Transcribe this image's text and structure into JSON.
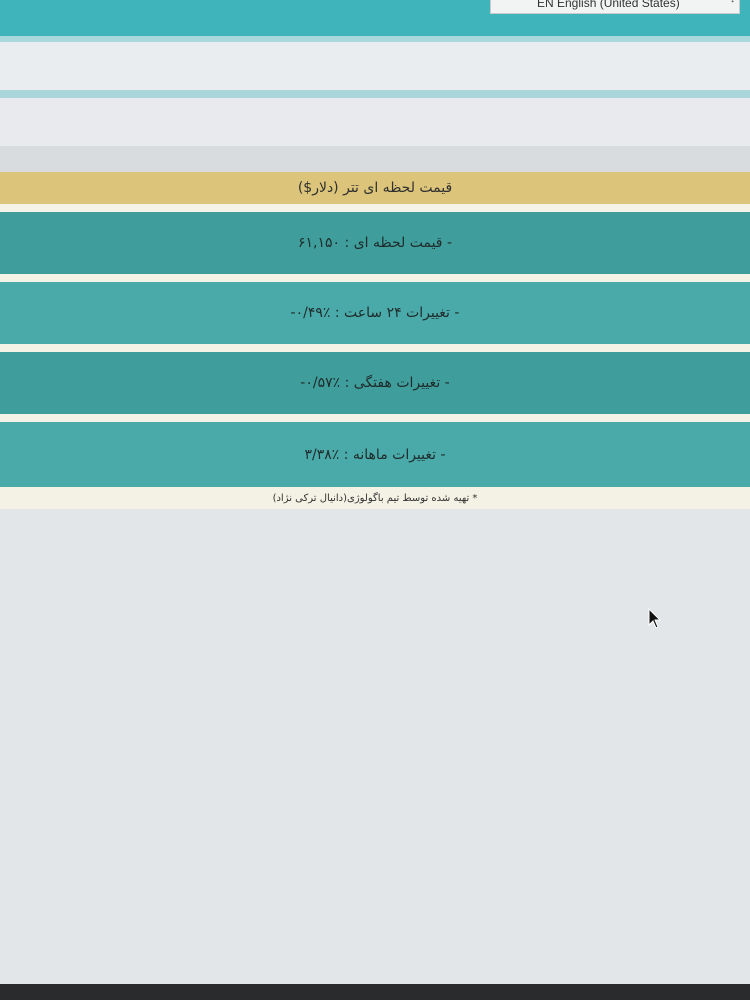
{
  "language_select": {
    "value": "EN English (United States)"
  },
  "header": {
    "title": "قیمت لحظه ای تتر (دلار$)"
  },
  "stats": [
    {
      "text": "- قیمت لحظه ای : ۶۱,۱۵۰"
    },
    {
      "text": "- تغییرات ۲۴ ساعت : ٪۰/۴۹-"
    },
    {
      "text": "- تغییرات هفتگی : ٪۰/۵۷-"
    },
    {
      "text": "- تغییرات ماهانه : ٪۳/۳۸"
    }
  ],
  "footnote": "* تهیه شده توسط تیم باگولوژی(دانیال ترکی نژاد)",
  "colors": {
    "top_band": "#3fb4bb",
    "title_bar": "#dcc57a",
    "stat_row": "#3f9e9c"
  },
  "icons": {
    "cursor": "mouse-pointer-icon",
    "select_arrow": "chevron-updown-icon"
  }
}
